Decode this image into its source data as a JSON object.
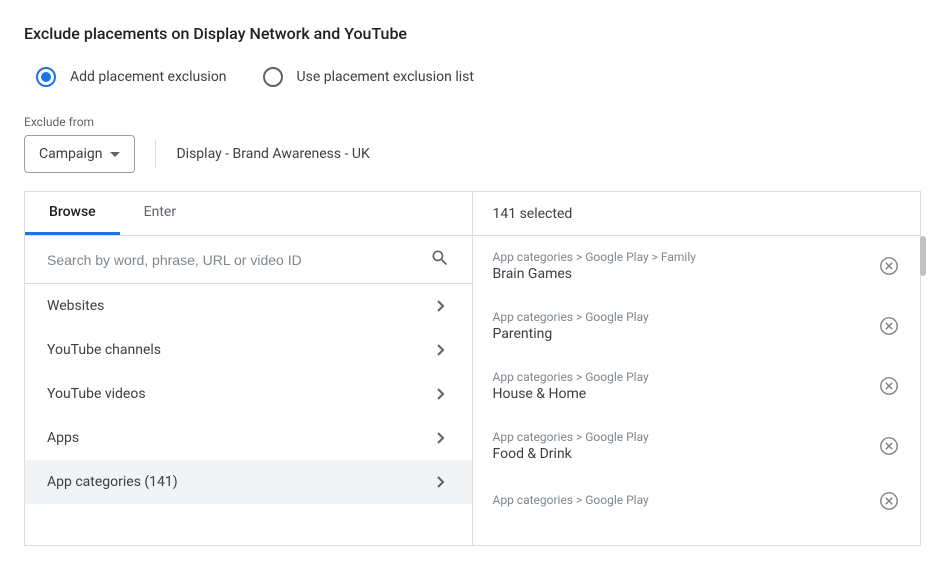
{
  "title": "Exclude placements on Display Network and YouTube",
  "radios": {
    "add": "Add placement exclusion",
    "use_list": "Use placement exclusion list"
  },
  "exclude_from_label": "Exclude from",
  "scope": {
    "value": "Campaign",
    "campaign_name": "Display - Brand Awareness - UK"
  },
  "tabs": {
    "browse": "Browse",
    "enter": "Enter"
  },
  "search": {
    "placeholder": "Search by word, phrase, URL or video ID"
  },
  "categories": [
    {
      "label": "Websites"
    },
    {
      "label": "YouTube channels"
    },
    {
      "label": "YouTube videos"
    },
    {
      "label": "Apps"
    },
    {
      "label": "App categories (141)"
    }
  ],
  "selected_header": "141 selected",
  "selected": [
    {
      "path": "App categories > Google Play > Family",
      "name": "Brain Games"
    },
    {
      "path": "App categories > Google Play",
      "name": "Parenting"
    },
    {
      "path": "App categories > Google Play",
      "name": "House & Home"
    },
    {
      "path": "App categories > Google Play",
      "name": "Food & Drink"
    },
    {
      "path": "App categories > Google Play",
      "name": ""
    }
  ]
}
